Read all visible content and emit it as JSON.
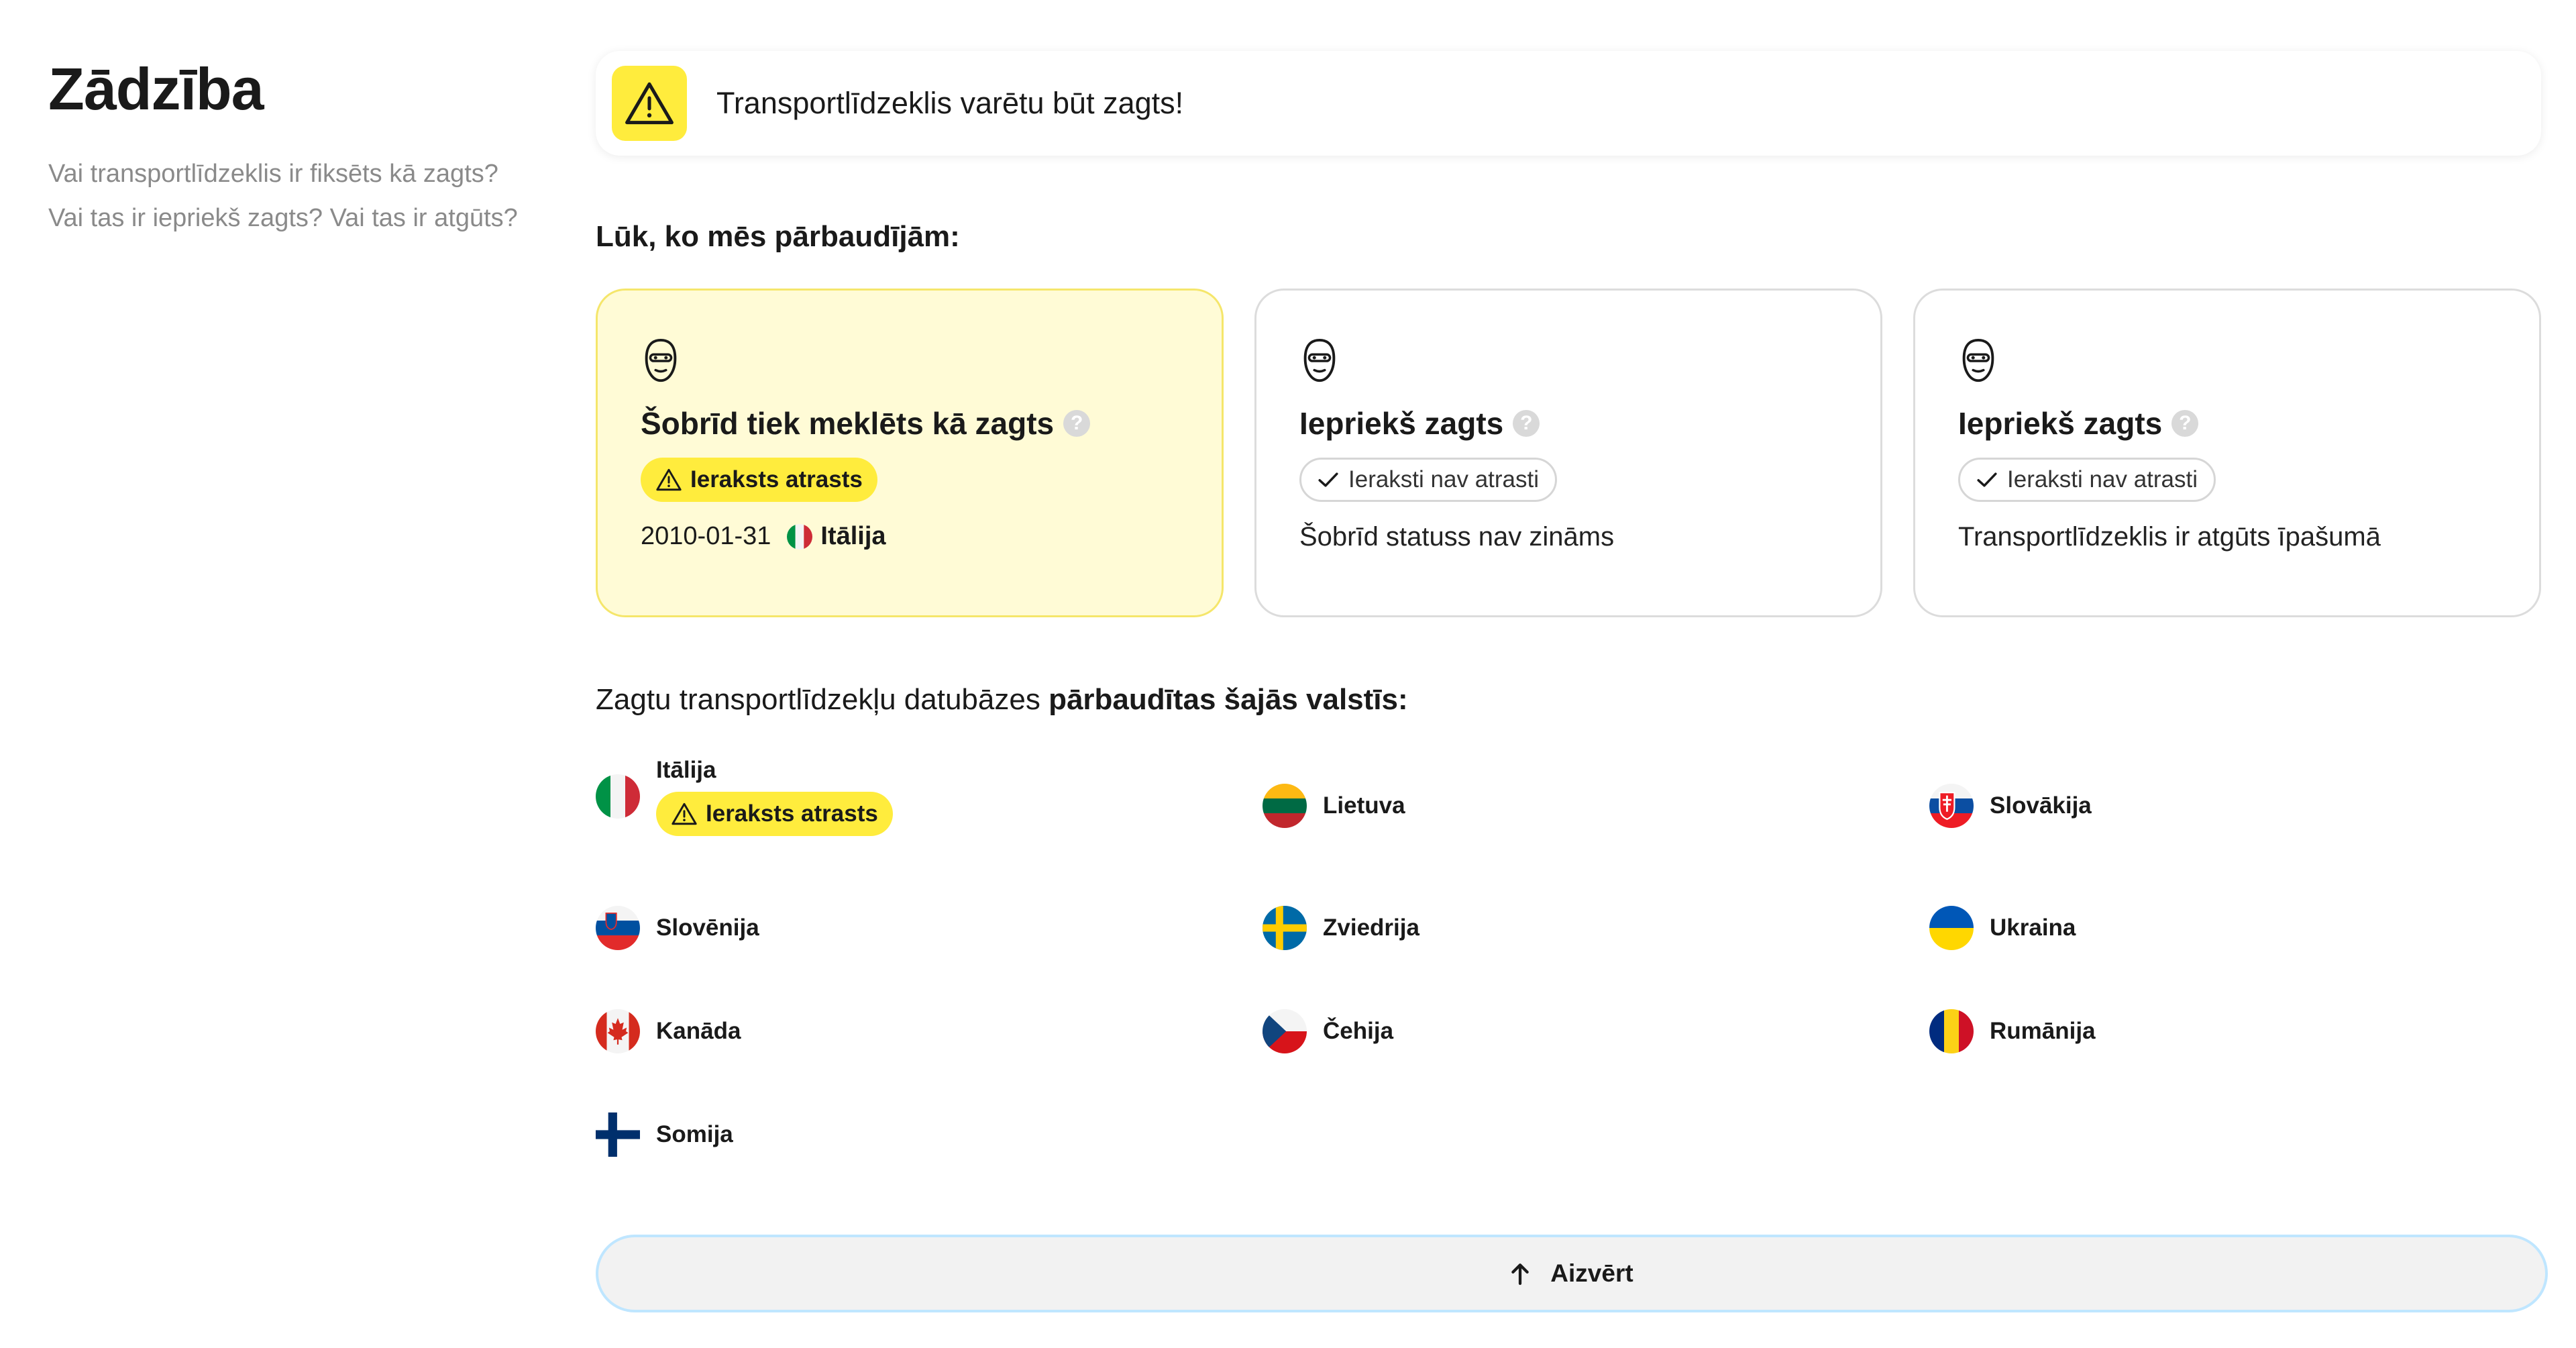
{
  "sidebar": {
    "title": "Zādzība",
    "description": "Vai transportlīdzeklis ir fiksēts kā zagts? Vai tas ir iepriekš zagts? Vai tas ir atgūts?"
  },
  "alert": {
    "text": "Transportlīdzeklis varētu būt zagts!",
    "icon": "warning-icon",
    "color": "#ffec3d"
  },
  "checked_title": "Lūk, ko mēs pārbaudījām:",
  "cards": [
    {
      "title": "Šobrīd tiek meklēts kā zagts",
      "help": "?",
      "badge": "Ieraksts atrasts",
      "status": "found",
      "date": "2010-01-31",
      "country": "Itālija"
    },
    {
      "title": "Iepriekš zagts",
      "help": "?",
      "badge": "Ieraksti nav atrasti",
      "status": "ok",
      "note": "Šobrīd statuss nav zināms"
    },
    {
      "title": "Iepriekš zagts",
      "help": "?",
      "badge": "Ieraksti nav atrasti",
      "status": "ok",
      "note": "Transportlīdzeklis ir atgūts īpašumā"
    }
  ],
  "db_title": {
    "prefix": "Zagtu transportlīdzekļu datubāzes ",
    "bold": "pārbaudītas šajās valstīs:"
  },
  "countries": [
    {
      "name": "Itālija",
      "badge": "Ieraksts atrasts"
    },
    {
      "name": "Lietuva"
    },
    {
      "name": "Slovākija"
    },
    {
      "name": "Slovēnija"
    },
    {
      "name": "Zviedrija"
    },
    {
      "name": "Ukraina"
    },
    {
      "name": "Kanāda"
    },
    {
      "name": "Čehija"
    },
    {
      "name": "Rumānija"
    },
    {
      "name": "Somija"
    }
  ],
  "close_button": {
    "label": "Aizvērt",
    "icon": "arrow-up-icon"
  }
}
